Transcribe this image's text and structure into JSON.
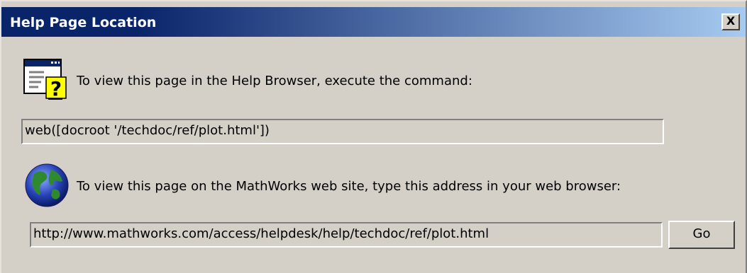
{
  "window": {
    "title": "Help Page Location",
    "close_label": "X",
    "titlebar_colors": {
      "start": "#0a246a",
      "end": "#a6caf0"
    },
    "face_color": "#d4d0c8"
  },
  "help_browser": {
    "icon": "help-window-icon",
    "instruction": "To view this page in the Help Browser, execute the command:",
    "command_value": "web([docroot '/techdoc/ref/plot.html'])"
  },
  "web_site": {
    "icon": "globe-icon",
    "instruction": "To view this page on the MathWorks web site, type this address in your web browser:",
    "url_value": "http://www.mathworks.com/access/helpdesk/help/techdoc/ref/plot.html",
    "go_label": "Go"
  }
}
